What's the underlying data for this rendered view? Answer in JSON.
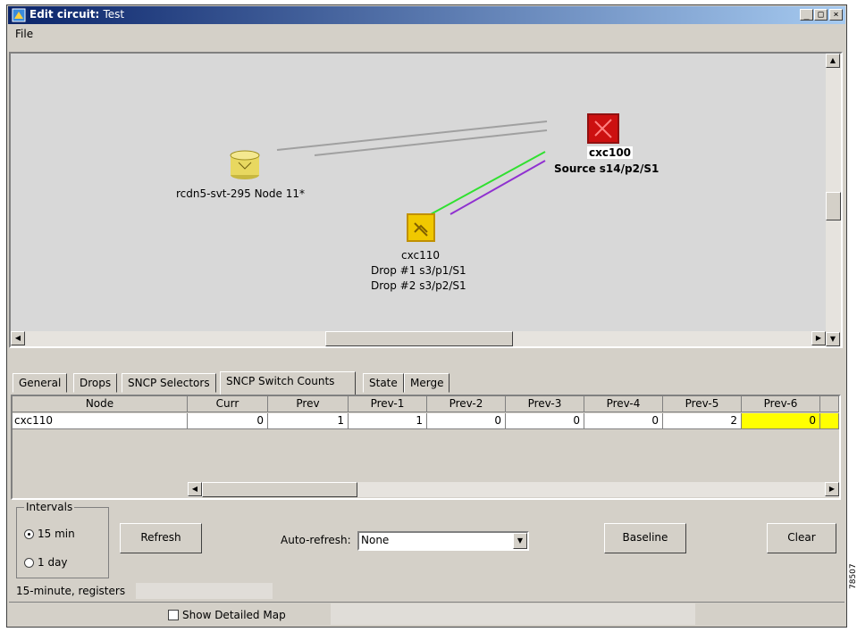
{
  "window": {
    "title_bold": "Edit circuit:",
    "title_name": "Test",
    "buttons": {
      "minimize": "_",
      "maximize": "□",
      "close": "×"
    }
  },
  "menu": {
    "file_label": "File"
  },
  "map": {
    "nodes": [
      {
        "name": "rcdn5-svt-295 Node 11*",
        "color": "#e8d860"
      },
      {
        "name": "cxc110",
        "lines": [
          "Drop #1 s3/p1/S1",
          "Drop #2 s3/p2/S1"
        ],
        "color": "#f0c800"
      },
      {
        "name": "cxc100",
        "lines": [
          "Source s14/p2/S1"
        ],
        "color": "#cc1010"
      }
    ],
    "path_colors": {
      "primary": "#30e030",
      "secondary": "#9030d0",
      "gray": "#a0a0a0"
    }
  },
  "tabs": [
    {
      "label": "General",
      "active": false
    },
    {
      "label": "Drops",
      "active": false
    },
    {
      "label": "SNCP Selectors",
      "active": false
    },
    {
      "label": "SNCP Switch Counts",
      "active": true
    },
    {
      "label": "State",
      "active": false
    },
    {
      "label": "Merge",
      "active": false
    }
  ],
  "table": {
    "columns": [
      "Node",
      "Curr",
      "Prev",
      "Prev-1",
      "Prev-2",
      "Prev-3",
      "Prev-4",
      "Prev-5",
      "Prev-6"
    ],
    "rows": [
      [
        "cxc110",
        "0",
        "1",
        "1",
        "0",
        "0",
        "0",
        "2",
        "0"
      ]
    ],
    "highlight_color": "#ffff00"
  },
  "intervals": {
    "legend": "Intervals",
    "options": [
      {
        "label": "15 min",
        "selected": true
      },
      {
        "label": "1 day",
        "selected": false
      }
    ]
  },
  "controls": {
    "refresh_label": "Refresh",
    "auto_refresh_label": "Auto-refresh:",
    "auto_refresh_value": "None",
    "baseline_label": "Baseline",
    "clear_label": "Clear"
  },
  "status": {
    "text": "15-minute, registers"
  },
  "footer": {
    "show_map_label": "Show Detailed Map",
    "side_number": "78507"
  }
}
